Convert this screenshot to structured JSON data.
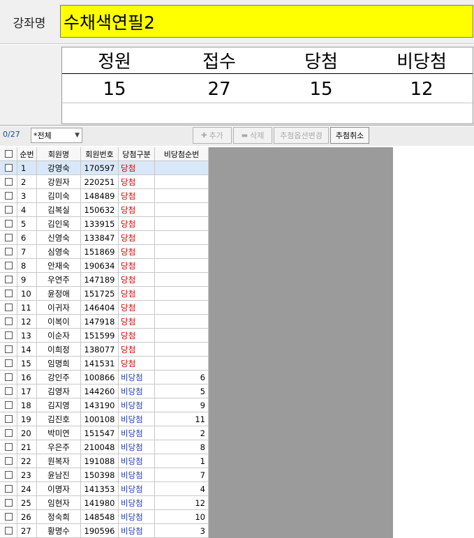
{
  "course": {
    "label": "강좌명",
    "name": "수채색연필2"
  },
  "summary": {
    "headers": [
      "정원",
      "접수",
      "당첨",
      "비당첨"
    ],
    "values": [
      "15",
      "27",
      "15",
      "12"
    ]
  },
  "toolbar": {
    "count": "0/27",
    "filter_value": "*전체",
    "add_label": "추가",
    "delete_label": "삭제",
    "option_change_label": "추첨옵션변경",
    "cancel_draw_label": "추첨취소"
  },
  "grid": {
    "columns": [
      "순번",
      "회원명",
      "회원번호",
      "당첨구분",
      "비당첨순번"
    ],
    "rows": [
      {
        "no": "1",
        "name": "강영숙",
        "id": "170597",
        "type": "당첨",
        "rank": ""
      },
      {
        "no": "2",
        "name": "강원자",
        "id": "220251",
        "type": "당첨",
        "rank": ""
      },
      {
        "no": "3",
        "name": "김미숙",
        "id": "148489",
        "type": "당첨",
        "rank": ""
      },
      {
        "no": "4",
        "name": "김복실",
        "id": "150632",
        "type": "당첨",
        "rank": ""
      },
      {
        "no": "5",
        "name": "김인욱",
        "id": "133915",
        "type": "당첨",
        "rank": ""
      },
      {
        "no": "6",
        "name": "신영숙",
        "id": "133847",
        "type": "당첨",
        "rank": ""
      },
      {
        "no": "7",
        "name": "심영숙",
        "id": "151869",
        "type": "당첨",
        "rank": ""
      },
      {
        "no": "8",
        "name": "안재숙",
        "id": "190634",
        "type": "당첨",
        "rank": ""
      },
      {
        "no": "9",
        "name": "우연주",
        "id": "147189",
        "type": "당첨",
        "rank": ""
      },
      {
        "no": "10",
        "name": "윤정애",
        "id": "151725",
        "type": "당첨",
        "rank": ""
      },
      {
        "no": "11",
        "name": "이귀자",
        "id": "146404",
        "type": "당첨",
        "rank": ""
      },
      {
        "no": "12",
        "name": "이복이",
        "id": "147918",
        "type": "당첨",
        "rank": ""
      },
      {
        "no": "13",
        "name": "이순자",
        "id": "151599",
        "type": "당첨",
        "rank": ""
      },
      {
        "no": "14",
        "name": "이희정",
        "id": "138077",
        "type": "당첨",
        "rank": ""
      },
      {
        "no": "15",
        "name": "임명희",
        "id": "141531",
        "type": "당첨",
        "rank": ""
      },
      {
        "no": "16",
        "name": "강인주",
        "id": "100866",
        "type": "비당첨",
        "rank": "6"
      },
      {
        "no": "17",
        "name": "김영자",
        "id": "144260",
        "type": "비당첨",
        "rank": "5"
      },
      {
        "no": "18",
        "name": "김지영",
        "id": "143190",
        "type": "비당첨",
        "rank": "9"
      },
      {
        "no": "19",
        "name": "김진호",
        "id": "100108",
        "type": "비당첨",
        "rank": "11"
      },
      {
        "no": "20",
        "name": "박미연",
        "id": "151547",
        "type": "비당첨",
        "rank": "2"
      },
      {
        "no": "21",
        "name": "우은주",
        "id": "210048",
        "type": "비당첨",
        "rank": "8"
      },
      {
        "no": "22",
        "name": "원복자",
        "id": "191088",
        "type": "비당첨",
        "rank": "1"
      },
      {
        "no": "23",
        "name": "윤남진",
        "id": "150398",
        "type": "비당첨",
        "rank": "7"
      },
      {
        "no": "24",
        "name": "이명자",
        "id": "141353",
        "type": "비당첨",
        "rank": "4"
      },
      {
        "no": "25",
        "name": "임현자",
        "id": "141980",
        "type": "비당첨",
        "rank": "12"
      },
      {
        "no": "26",
        "name": "정숙희",
        "id": "148548",
        "type": "비당첨",
        "rank": "10"
      },
      {
        "no": "27",
        "name": "황명수",
        "id": "190596",
        "type": "비당첨",
        "rank": "3"
      }
    ]
  },
  "colors": {
    "course_highlight": "#ffff00",
    "win": "#d40000",
    "lose": "#1f3aa8",
    "panel_gray": "#9b9b9b"
  }
}
